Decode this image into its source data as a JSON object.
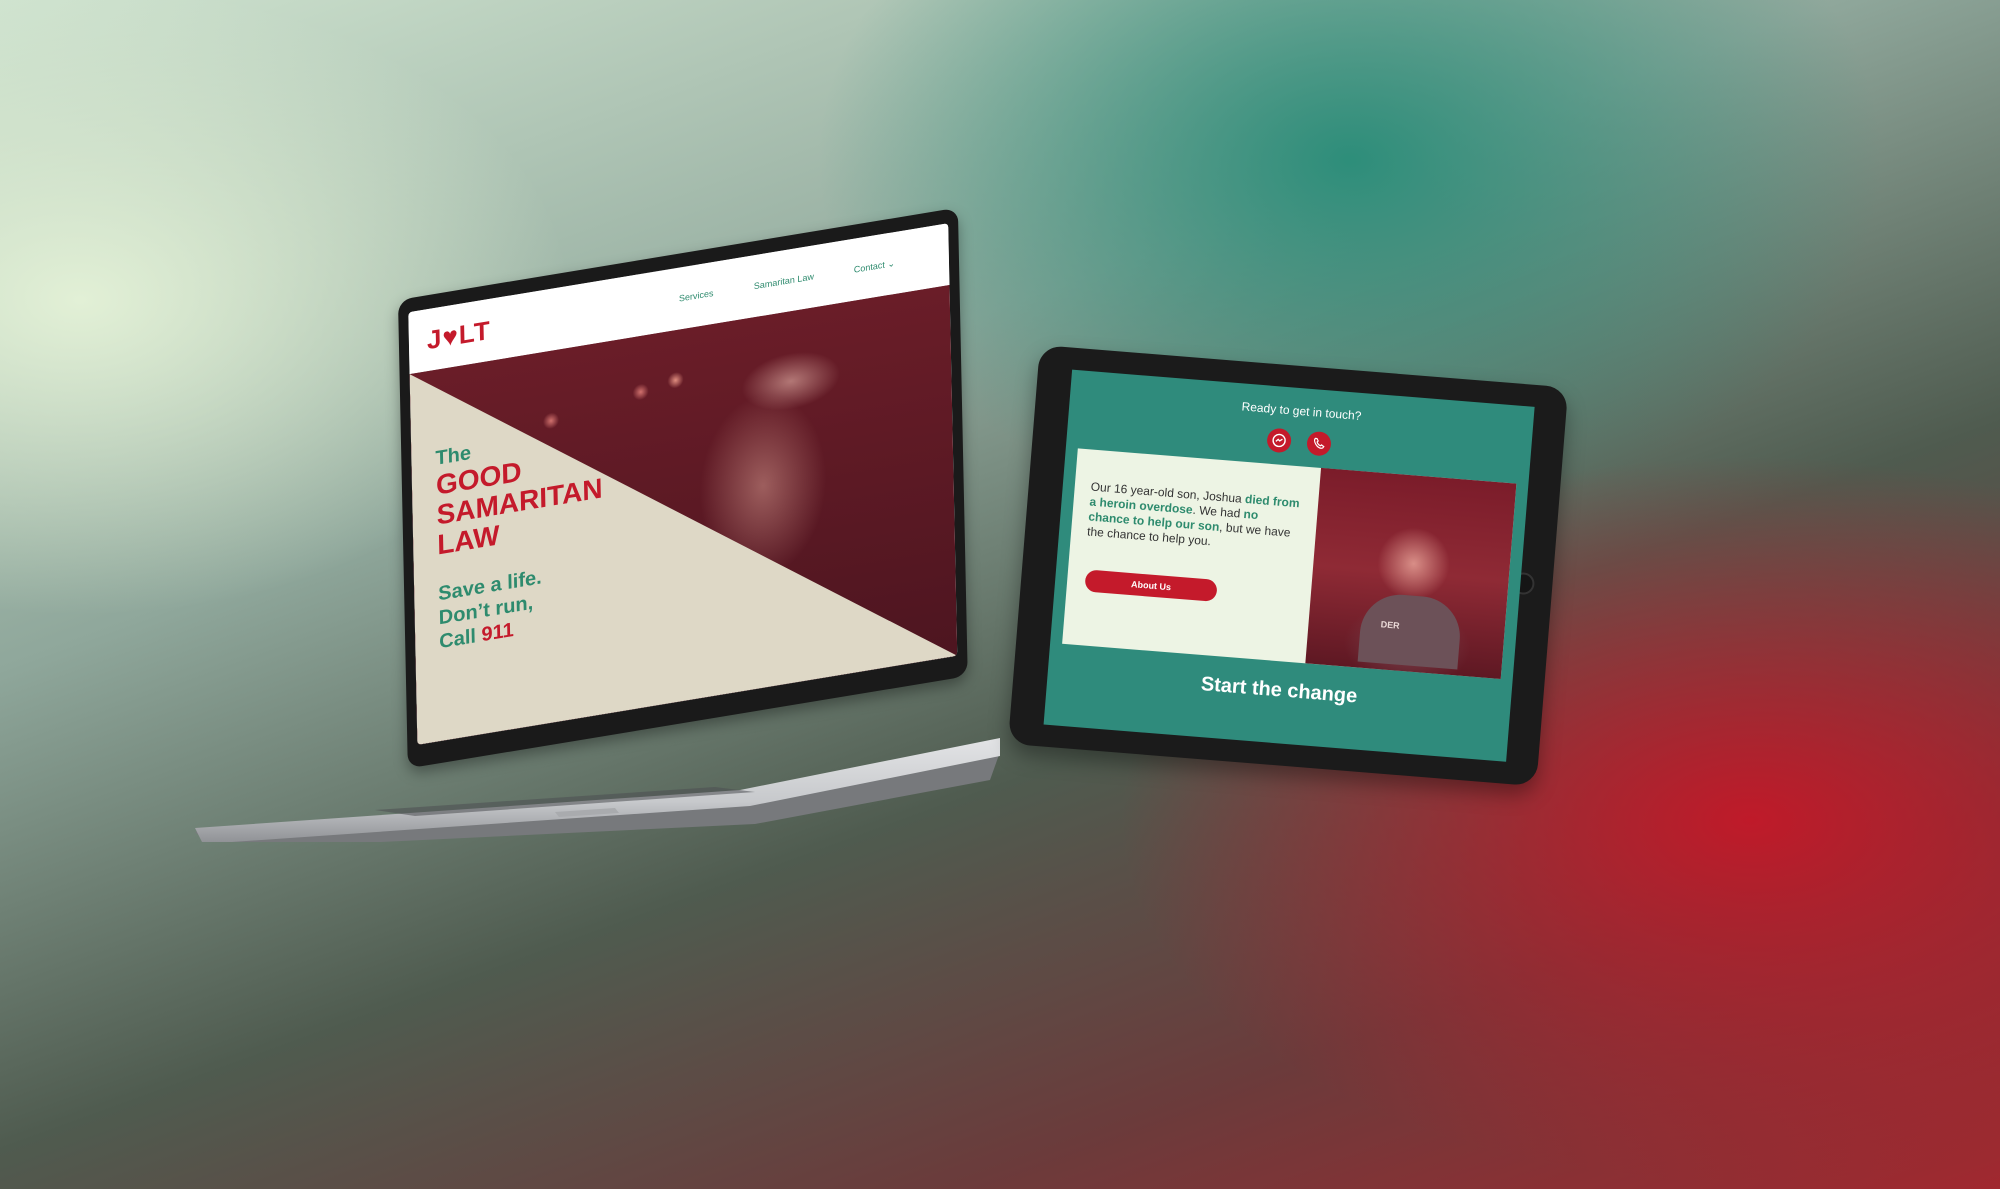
{
  "laptop": {
    "logo": "J♥LT",
    "nav": {
      "services": "Services",
      "samaritan_law": "Samaritan Law",
      "contact": "Contact",
      "contact_chevron": "⌄"
    },
    "hero": {
      "the": "The",
      "line1": "GOOD",
      "line2": "SAMARITAN",
      "line3": "LAW",
      "tag1_a": "Save a ",
      "tag1_b": "life.",
      "tag2": "Don’t run,",
      "tag3_a": "Call ",
      "tag3_b": "911"
    }
  },
  "tablet": {
    "cta": "Ready to get in touch?",
    "icons": {
      "messenger": "messenger-icon",
      "phone": "phone-icon"
    },
    "quote": {
      "p1": "Our 16 year-old son, Joshua ",
      "b1": "died from a heroin overdose",
      "p2": ". We had ",
      "b2": "no chance to help our son",
      "p3": ", but we have the chance to help you."
    },
    "button": "About Us",
    "photo_shirt_text": "DER",
    "start": "Start the change"
  },
  "colors": {
    "brand_red": "#c41a2b",
    "brand_green": "#2e8b6e",
    "teal_bg": "#2f8b7c",
    "cream": "#ded8c6"
  }
}
